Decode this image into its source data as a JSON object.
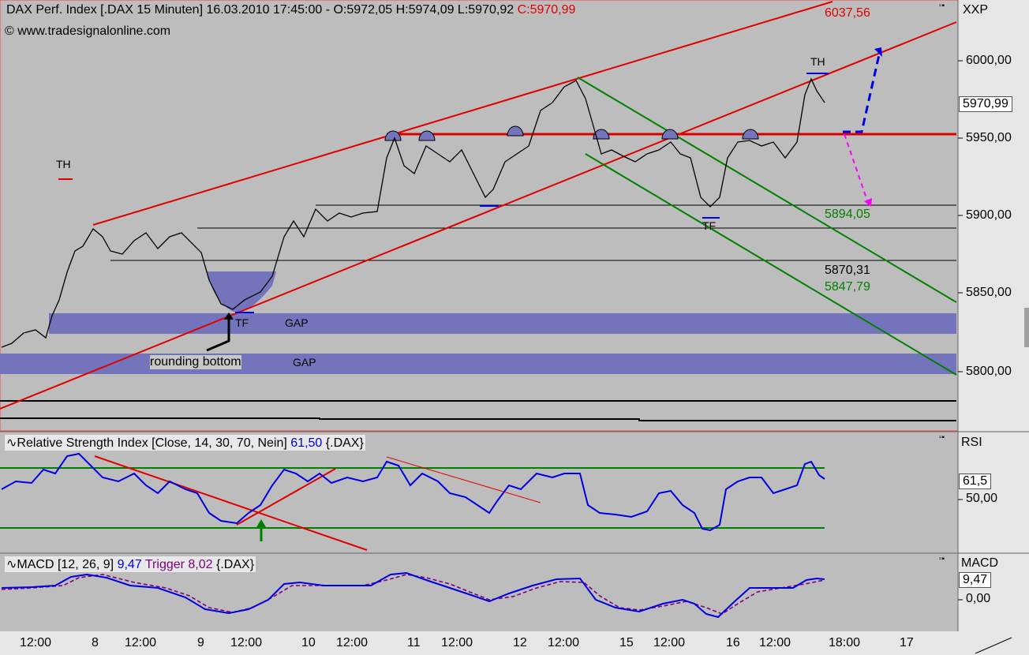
{
  "header": {
    "title": "DAX Perf. Index [.DAX  15 Minuten] 16.03.2010 17:45:00 - O:5972,05 H:5974,09 L:5970,92",
    "close": "C:5970,99",
    "copyright": "© www.tradesignalonline.com",
    "axis_name": "XXP"
  },
  "price_panel": {
    "y_ticks": [
      "6000,00",
      "5950,00",
      "5900,00",
      "5850,00",
      "5800,00"
    ],
    "last_price": "5970,99",
    "labels": {
      "top_red": "6037,56",
      "green1": "5894,05",
      "black1": "5870,31",
      "green2": "5847,79",
      "th_left": "TH",
      "th_right": "TH",
      "tf_left": "TF",
      "tf_right": "TF",
      "gap1": "GAP",
      "gap2": "GAP",
      "rounding": "rounding bottom"
    }
  },
  "rsi_panel": {
    "title": "Relative Strength Index [Close, 14, 30, 70, Nein]",
    "value": "61,50",
    "symbol": "{.DAX}",
    "axis_name": "RSI",
    "tag": "61,5",
    "tick": "50,00"
  },
  "macd_panel": {
    "title": "MACD [12, 26, 9]",
    "value": "9,47",
    "trigger": "Trigger 8,02",
    "symbol": "{.DAX}",
    "axis_name": "MACD",
    "tag": "9,47",
    "tick": "0,00"
  },
  "x_ticks": [
    "12:00",
    "8",
    "12:00",
    "9",
    "12:00",
    "10",
    "12:00",
    "11",
    "12:00",
    "12",
    "12:00",
    "15",
    "12:00",
    "16",
    "12:00",
    "18:00",
    "17"
  ],
  "colors": {
    "price_up": "#d00000",
    "price_down": "#000000",
    "support": "#e00000",
    "channel": "#008000",
    "gap": "#7070b8",
    "rsi": "#0000e0",
    "trigger": "#800080"
  },
  "chart_data": {
    "type": "line",
    "title": "DAX Perf. Index [.DAX  15 Minuten]",
    "ylim": [
      5765,
      6040
    ],
    "levels": [
      6037.56,
      5950,
      5905,
      5894.05,
      5870.31,
      5847.79
    ],
    "series": [
      {
        "name": "DAX Perf. Index",
        "x": [
          "8",
          "9",
          "10",
          "11",
          "12",
          "15",
          "16"
        ],
        "values": [
          5885,
          5840,
          5895,
          5945,
          5960,
          5940,
          5970.99
        ]
      },
      {
        "name": "Relative Strength Index",
        "values": [
          61.5
        ]
      },
      {
        "name": "MACD",
        "values": [
          9.47
        ]
      },
      {
        "name": "Trigger",
        "values": [
          8.02
        ]
      }
    ]
  }
}
